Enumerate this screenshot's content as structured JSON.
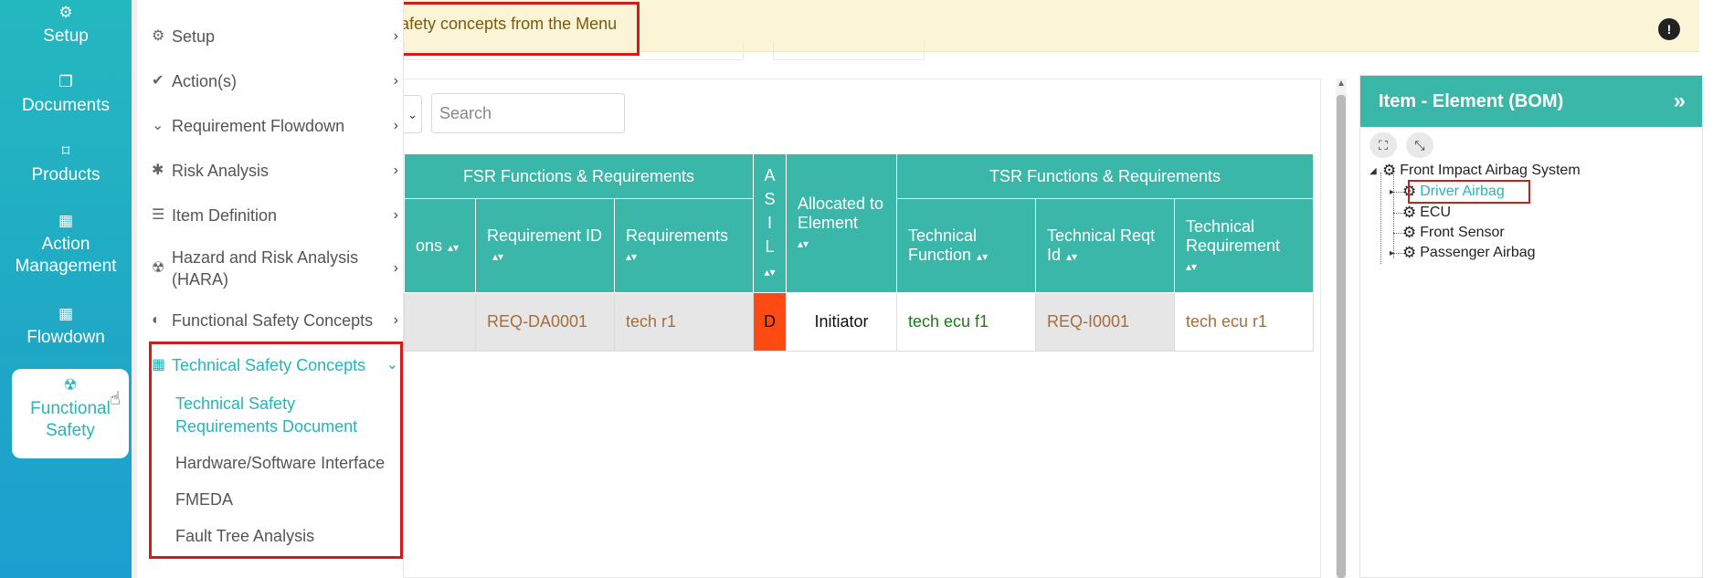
{
  "rail": {
    "items": [
      {
        "label": "Setup",
        "icon": "gears-icon"
      },
      {
        "label": "Documents",
        "icon": "copy-icon"
      },
      {
        "label": "Products",
        "icon": "product-icon"
      },
      {
        "label": "Action Management",
        "icon": "building-icon"
      },
      {
        "label": "Flowdown",
        "icon": "building-icon"
      },
      {
        "label": "Functional Safety",
        "icon": "radiation-icon",
        "active": true
      }
    ]
  },
  "menu": {
    "items": [
      {
        "label": "Setup",
        "icon": "gears-icon"
      },
      {
        "label": "Action(s)",
        "icon": "check-icon"
      },
      {
        "label": "Requirement Flowdown",
        "icon": "double-chevron-down-icon"
      },
      {
        "label": "Risk Analysis",
        "icon": "bug-icon"
      },
      {
        "label": "Item Definition",
        "icon": "list-icon"
      },
      {
        "label": "Hazard and Risk Analysis (HARA)",
        "icon": "radiation-icon"
      },
      {
        "label": "Functional Safety Concepts",
        "icon": "shield-icon"
      },
      {
        "label": "Technical Safety Concepts",
        "icon": "building-icon",
        "active": true
      }
    ],
    "subitems": [
      {
        "label": "Technical Safety Requirements Document",
        "active": true
      },
      {
        "label": "Hardware/Software Interface"
      },
      {
        "label": "FMEDA"
      },
      {
        "label": "Fault Tree Analysis"
      }
    ]
  },
  "notice": {
    "text": "afety concepts from the Menu",
    "icon_label": "!"
  },
  "toolbar": {
    "search_placeholder": "Search"
  },
  "table": {
    "groups": {
      "fsr": "FSR Functions & Requirements",
      "asil": "A S I L",
      "allocated": "Allocated to Element",
      "tsr": "TSR Functions & Requirements"
    },
    "columns": {
      "fsr_functions_partial": "ons",
      "requirement_id": "Requirement ID",
      "requirements": "Requirements",
      "technical_function": "Technical Function",
      "technical_reqt_id": "Technical Reqt Id",
      "technical_requirement": "Technical Requirement"
    },
    "rows": [
      {
        "fsr_function": "",
        "requirement_id": "REQ-DA0001",
        "requirements": "tech r1",
        "asil": "D",
        "allocated": "Initiator",
        "technical_function": "tech ecu f1",
        "technical_reqt_id": "REQ-I0001",
        "technical_requirement": "tech ecu r1"
      }
    ]
  },
  "bom": {
    "title": "Item - Element (BOM)",
    "tree": {
      "root": "Front Impact Airbag System",
      "children": [
        {
          "label": "Driver Airbag",
          "selected": true,
          "expandable": true
        },
        {
          "label": "ECU"
        },
        {
          "label": "Front Sensor"
        },
        {
          "label": "Passenger Airbag",
          "expandable": true
        }
      ]
    }
  },
  "colors": {
    "teal": "#3ab7a8",
    "rail": "#24b8bf",
    "highlight_red": "#d01c1c",
    "asil_d": "#ff4a14",
    "notice_bg": "#fbf4d6"
  }
}
